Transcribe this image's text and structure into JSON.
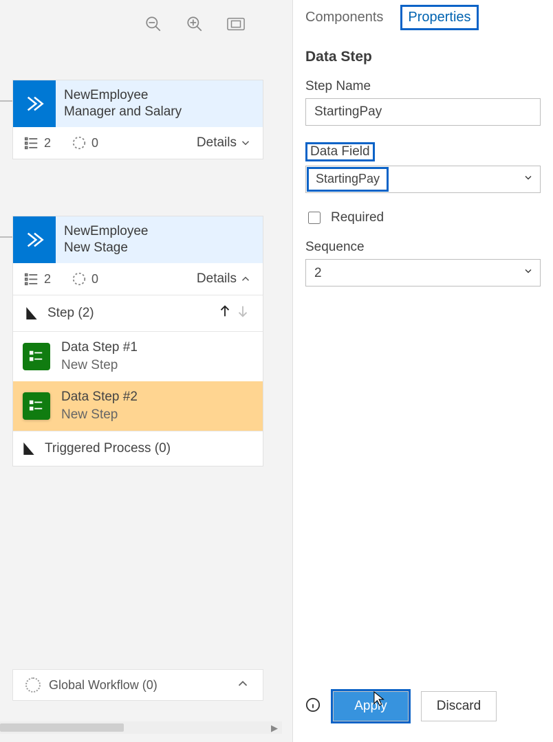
{
  "canvas": {
    "stage1": {
      "title1": "NewEmployee",
      "title2": "Manager and Salary",
      "stepCount": "2",
      "triggerCount": "0",
      "detailsLabel": "Details"
    },
    "stage2": {
      "title1": "NewEmployee",
      "title2": "New Stage",
      "stepCount": "2",
      "triggerCount": "0",
      "detailsLabel": "Details",
      "stepHeader": "Step (2)",
      "steps": [
        {
          "line1": "Data Step #1",
          "line2": "New Step"
        },
        {
          "line1": "Data Step #2",
          "line2": "New Step"
        }
      ],
      "triggered": "Triggered Process (0)"
    },
    "globalWorkflow": "Global Workflow (0)"
  },
  "panel": {
    "tabs": {
      "components": "Components",
      "properties": "Properties"
    },
    "heading": "Data Step",
    "stepNameLabel": "Step Name",
    "stepNameValue": "StartingPay",
    "dataFieldLabel": "Data Field",
    "dataFieldValue": "StartingPay",
    "requiredLabel": "Required",
    "sequenceLabel": "Sequence",
    "sequenceValue": "2",
    "applyLabel": "Apply",
    "discardLabel": "Discard"
  }
}
